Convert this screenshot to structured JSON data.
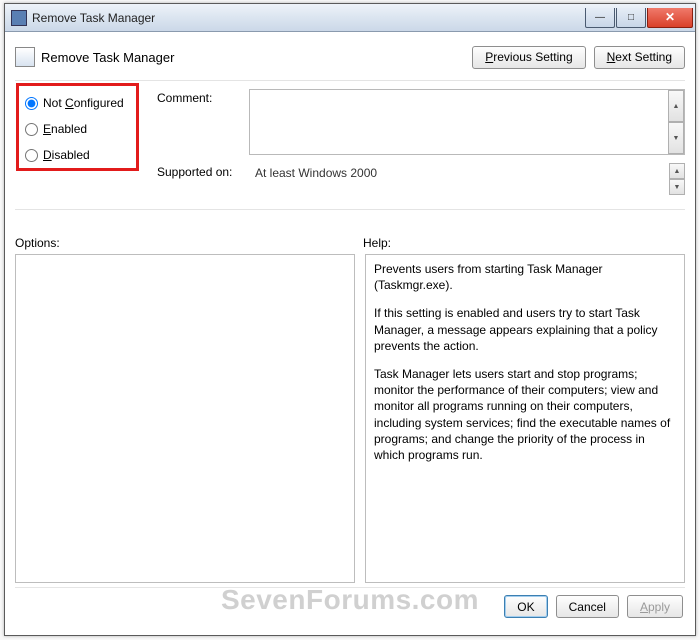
{
  "window": {
    "title": "Remove Task Manager"
  },
  "policy": {
    "title": "Remove Task Manager"
  },
  "nav": {
    "prev": "revious Setting",
    "prev_u": "P",
    "next": "ext Setting",
    "next_u": "N"
  },
  "radios": {
    "not_configured_u": "C",
    "not_configured_pre": "Not ",
    "not_configured_post": "onfigured",
    "enabled_u": "E",
    "enabled_post": "nabled",
    "disabled_u": "D",
    "disabled_post": "isabled",
    "selected": "not_configured"
  },
  "labels": {
    "comment": "Comment:",
    "supported": "Supported on:",
    "options": "Options:",
    "help": "Help:"
  },
  "supported_text": "At least Windows 2000",
  "help": {
    "p1": "Prevents users from starting Task Manager (Taskmgr.exe).",
    "p2": "If this setting is enabled and users try to start Task Manager, a message appears explaining that a policy prevents the action.",
    "p3": "Task Manager lets users start and stop programs; monitor the performance of their computers; view and monitor all programs running on their computers, including system services; find the executable names of programs; and change the priority of the process in which programs run."
  },
  "buttons": {
    "ok": "OK",
    "cancel": "Cancel",
    "apply_u": "A",
    "apply_post": "pply"
  },
  "watermark": "SevenForums.com"
}
